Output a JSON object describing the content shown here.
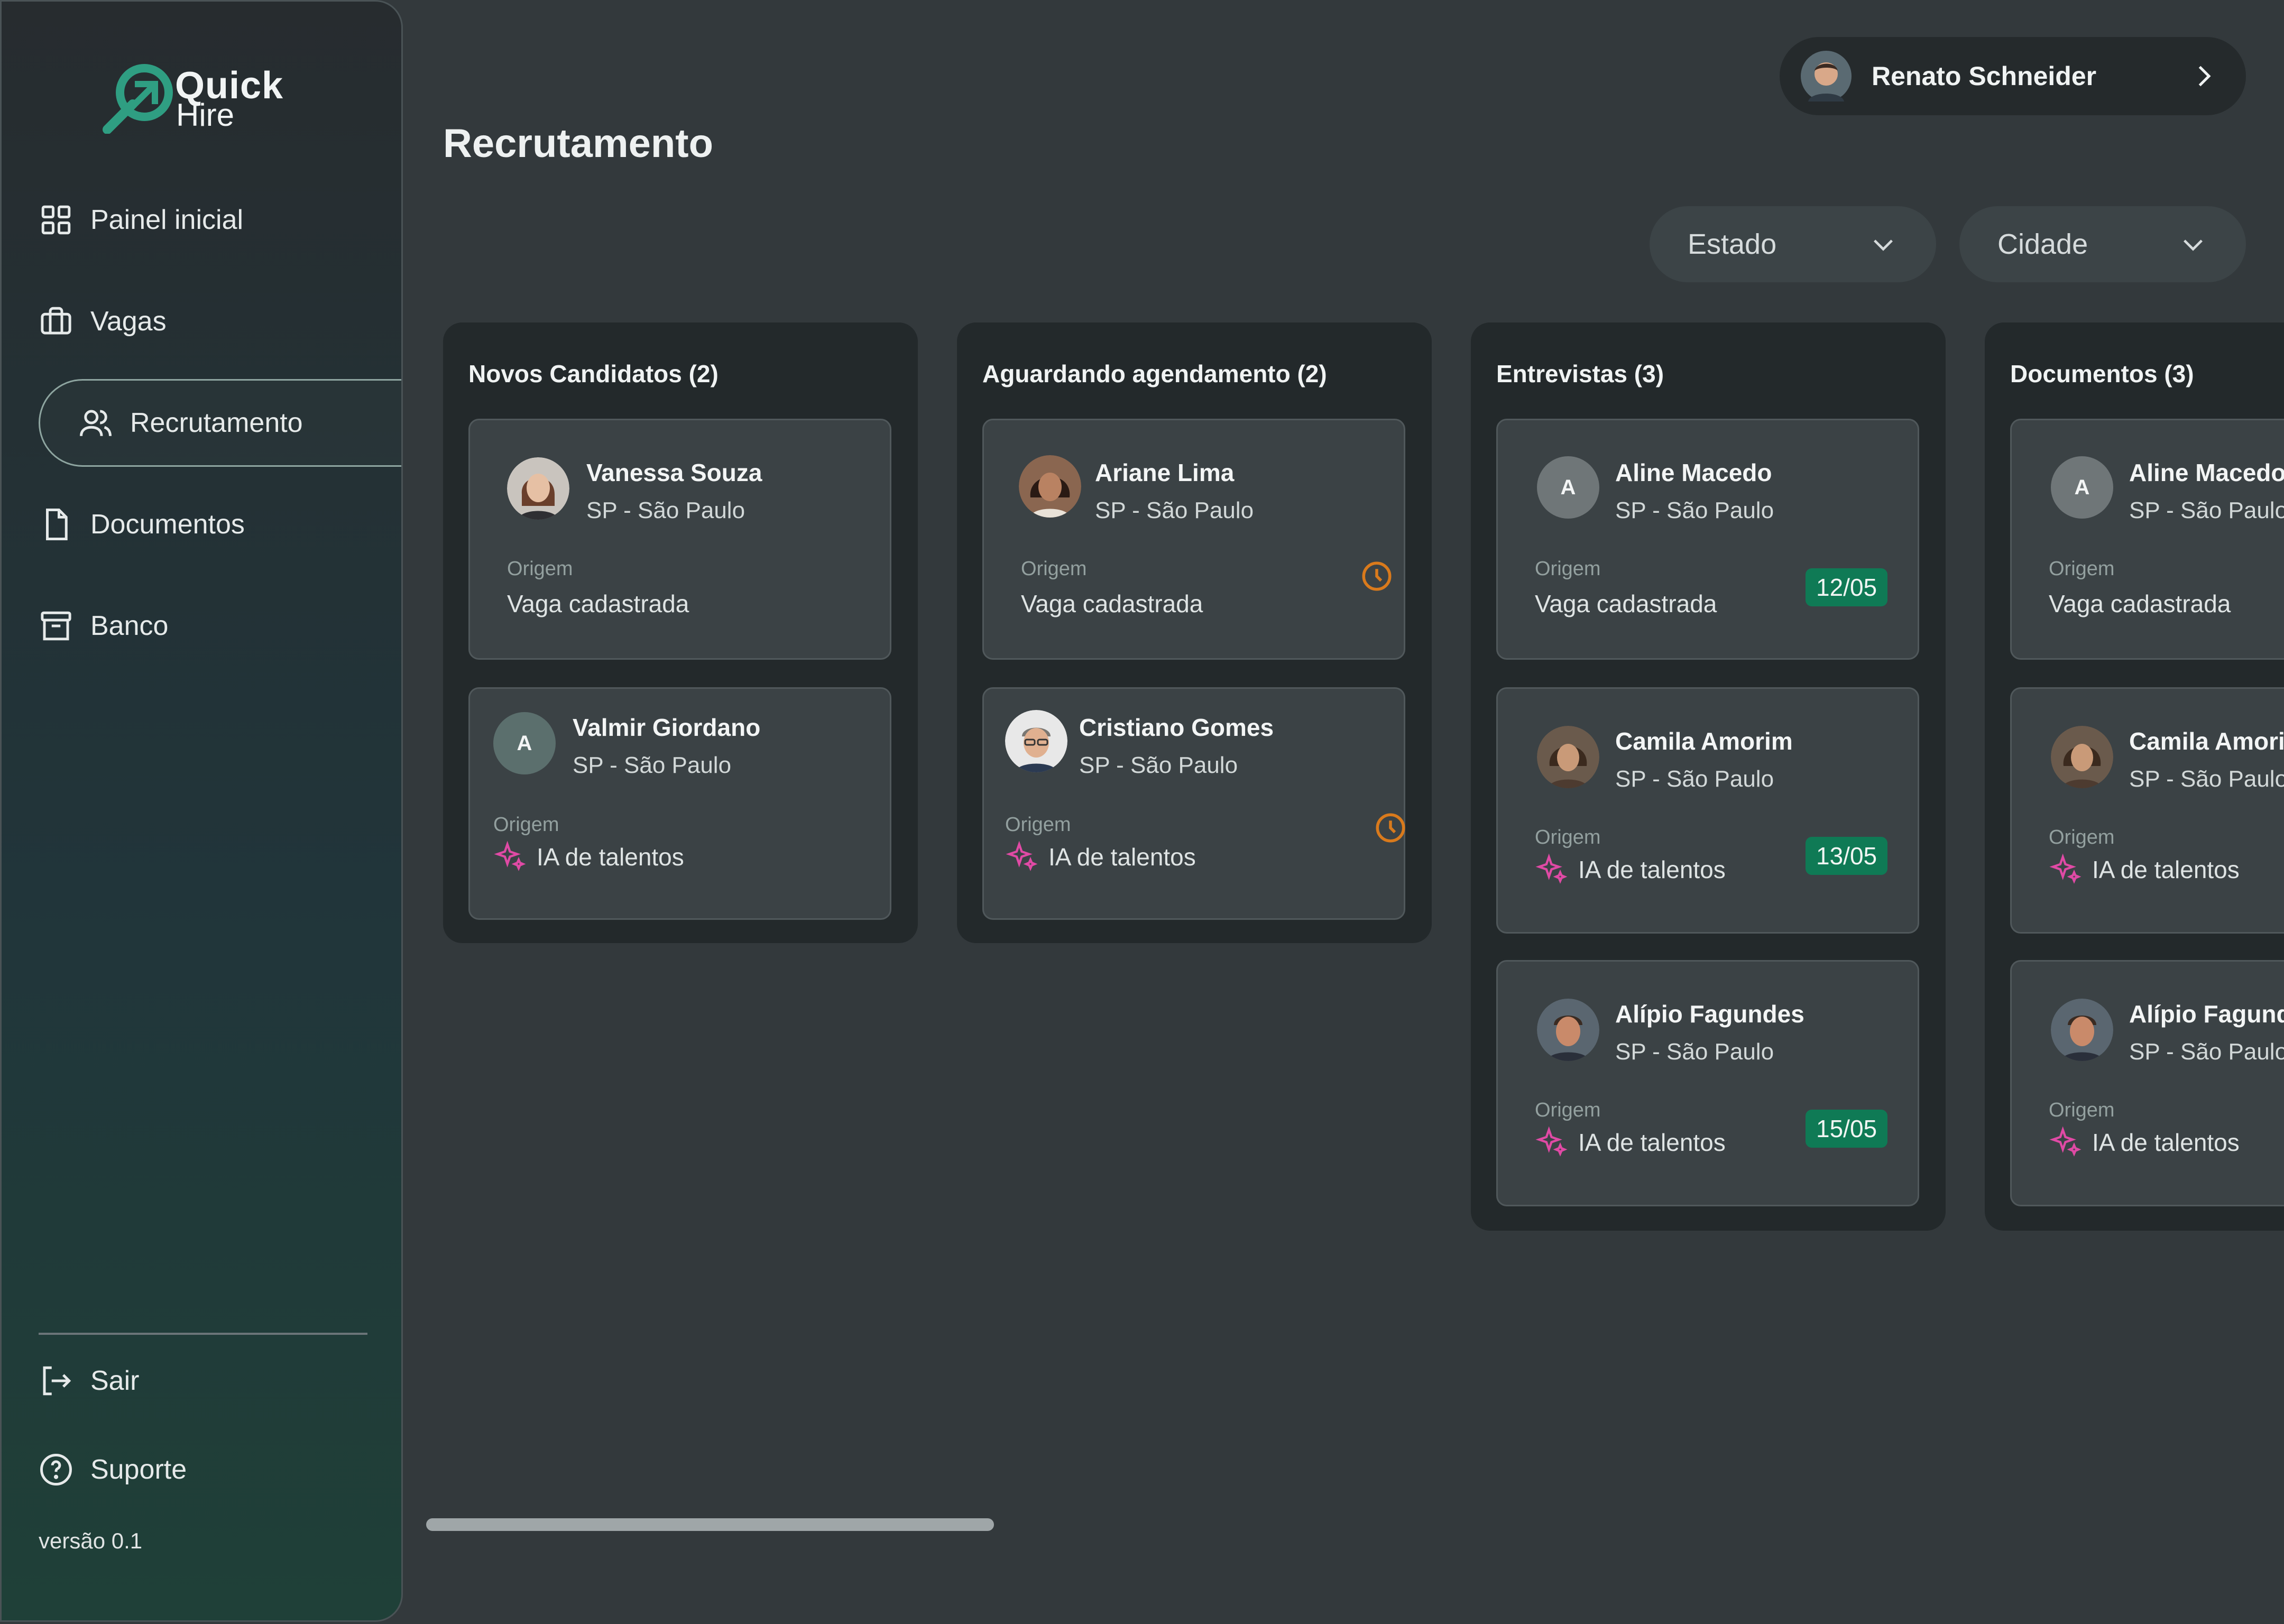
{
  "app": {
    "logo_line1": "Quick",
    "logo_line2": "Hire",
    "accent_color": "#2f9e82"
  },
  "sidebar": {
    "items": [
      {
        "label": "Painel inicial",
        "icon": "grid-icon"
      },
      {
        "label": "Vagas",
        "icon": "briefcase-icon"
      },
      {
        "label": "Recrutamento",
        "icon": "users-icon",
        "active": true
      },
      {
        "label": "Documentos",
        "icon": "file-icon"
      },
      {
        "label": "Banco",
        "icon": "archive-icon"
      }
    ],
    "footer": [
      {
        "label": "Sair",
        "icon": "logout-icon"
      },
      {
        "label": "Suporte",
        "icon": "help-circle-icon"
      }
    ],
    "version": "versão 0.1"
  },
  "header": {
    "title": "Recrutamento",
    "user_name": "Renato Schneider"
  },
  "filters": {
    "state": "Estado",
    "city": "Cidade"
  },
  "labels": {
    "origin": "Origem"
  },
  "columns": [
    {
      "title": "Novos Candidatos (2)",
      "cards": [
        {
          "name": "Vanessa Souza",
          "location": "SP - São Paulo",
          "origin": "Vaga cadastrada",
          "avatar": "photo"
        },
        {
          "name": "Valmir Giordano",
          "location": "SP - São Paulo",
          "origin": "IA de talentos",
          "avatar_letter": "A"
        }
      ]
    },
    {
      "title": "Aguardando agendamento (2)",
      "cards": [
        {
          "name": "Ariane Lima",
          "location": "SP - São Paulo",
          "origin": "Vaga cadastrada",
          "avatar": "photo",
          "status_icon": "clock-icon"
        },
        {
          "name": "Cristiano Gomes",
          "location": "SP - São Paulo",
          "origin": "IA de talentos",
          "avatar": "photo",
          "status_icon": "clock-icon"
        }
      ]
    },
    {
      "title": "Entrevistas (3)",
      "cards": [
        {
          "name": "Aline Macedo",
          "location": "SP - São Paulo",
          "origin": "Vaga cadastrada",
          "avatar_letter": "A",
          "date": "12/05"
        },
        {
          "name": "Camila Amorim",
          "location": "SP - São Paulo",
          "origin": "IA de talentos",
          "avatar": "photo",
          "date": "13/05"
        },
        {
          "name": "Alípio Fagundes",
          "location": "SP - São Paulo",
          "origin": "IA de talentos",
          "avatar": "photo",
          "date": "15/05"
        }
      ]
    },
    {
      "title": "Documentos (3)",
      "cards": [
        {
          "name": "Aline Macedo",
          "location": "SP - São Paulo",
          "origin": "Vaga cadastrada",
          "avatar_letter": "A"
        },
        {
          "name": "Camila Amorim",
          "location": "SP - São Paulo",
          "origin": "IA de talentos",
          "avatar": "photo"
        },
        {
          "name": "Alípio Fagundes",
          "location": "SP - São Paulo",
          "origin": "IA de talentos",
          "avatar": "photo"
        }
      ]
    }
  ],
  "colors": {
    "date_badge": "#0f7a55",
    "clock": "#d97a1c",
    "sparkle": "#e04aa5"
  }
}
